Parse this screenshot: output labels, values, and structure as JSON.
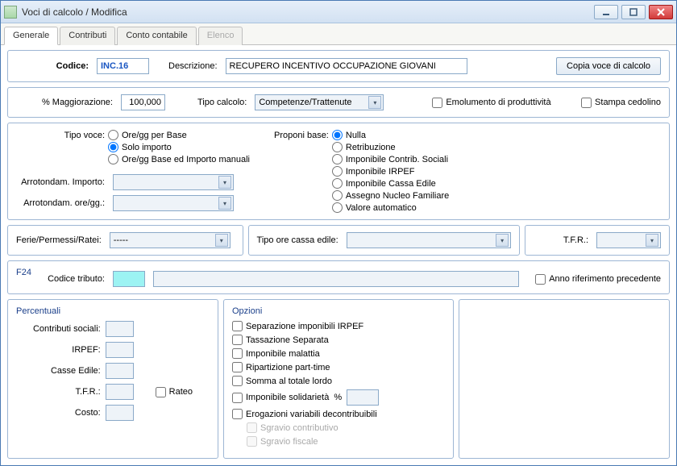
{
  "window": {
    "title": "Voci di calcolo / Modifica"
  },
  "tabs": {
    "generale": "Generale",
    "contributi": "Contributi",
    "conto": "Conto contabile",
    "elenco": "Elenco"
  },
  "row1": {
    "codice_label": "Codice:",
    "codice_value": "INC.16",
    "descr_label": "Descrizione:",
    "descr_value": "RECUPERO INCENTIVO OCCUPAZIONE GIOVANI",
    "copy_btn": "Copia voce di calcolo"
  },
  "row2": {
    "maggiorazione_label": "% Maggiorazione:",
    "maggiorazione_value": "100,000",
    "tipo_calcolo_label": "Tipo calcolo:",
    "tipo_calcolo_value": "Competenze/Trattenute",
    "emolumento": "Emolumento di produttività",
    "stampa": "Stampa cedolino"
  },
  "row3": {
    "tipo_voce_label": "Tipo voce:",
    "tipo_voce_opts": [
      "Ore/gg per Base",
      "Solo importo",
      "Ore/gg Base ed Importo manuali"
    ],
    "arrot_importo_label": "Arrotondam. Importo:",
    "arrot_ore_label": "Arrotondam. ore/gg.:",
    "proponi_label": "Proponi base:",
    "proponi_opts": [
      "Nulla",
      "Retribuzione",
      "Imponibile Contrib. Sociali",
      "Imponibile IRPEF",
      "Imponibile Cassa Edile",
      "Assegno Nucleo Familiare",
      "Valore automatico"
    ]
  },
  "row4": {
    "ferie_label": "Ferie/Permessi/Ratei:",
    "ferie_value": "-----",
    "tipo_ore_label": "Tipo ore cassa edile:",
    "tfr_label": "T.F.R.:"
  },
  "f24": {
    "title": "F24",
    "codice_tributo_label": "Codice tributo:",
    "anno_precedente": "Anno riferimento precedente"
  },
  "percentuali": {
    "title": "Percentuali",
    "contributi": "Contributi sociali:",
    "irpef": "IRPEF:",
    "casse": "Casse Edile:",
    "tfr": "T.F.R.:",
    "rateo": "Rateo",
    "costo": "Costo:"
  },
  "opzioni": {
    "title": "Opzioni",
    "items": [
      "Separazione imponibili IRPEF",
      "Tassazione Separata",
      "Imponibile malattia",
      "Ripartizione part-time",
      "Somma al totale lordo"
    ],
    "imponibile_solid": "Imponibile solidarietà",
    "percent_sign": "%",
    "erogazioni": "Erogazioni variabili decontribuibili",
    "sgravio_contrib": "Sgravio contributivo",
    "sgravio_fiscale": "Sgravio fiscale"
  }
}
